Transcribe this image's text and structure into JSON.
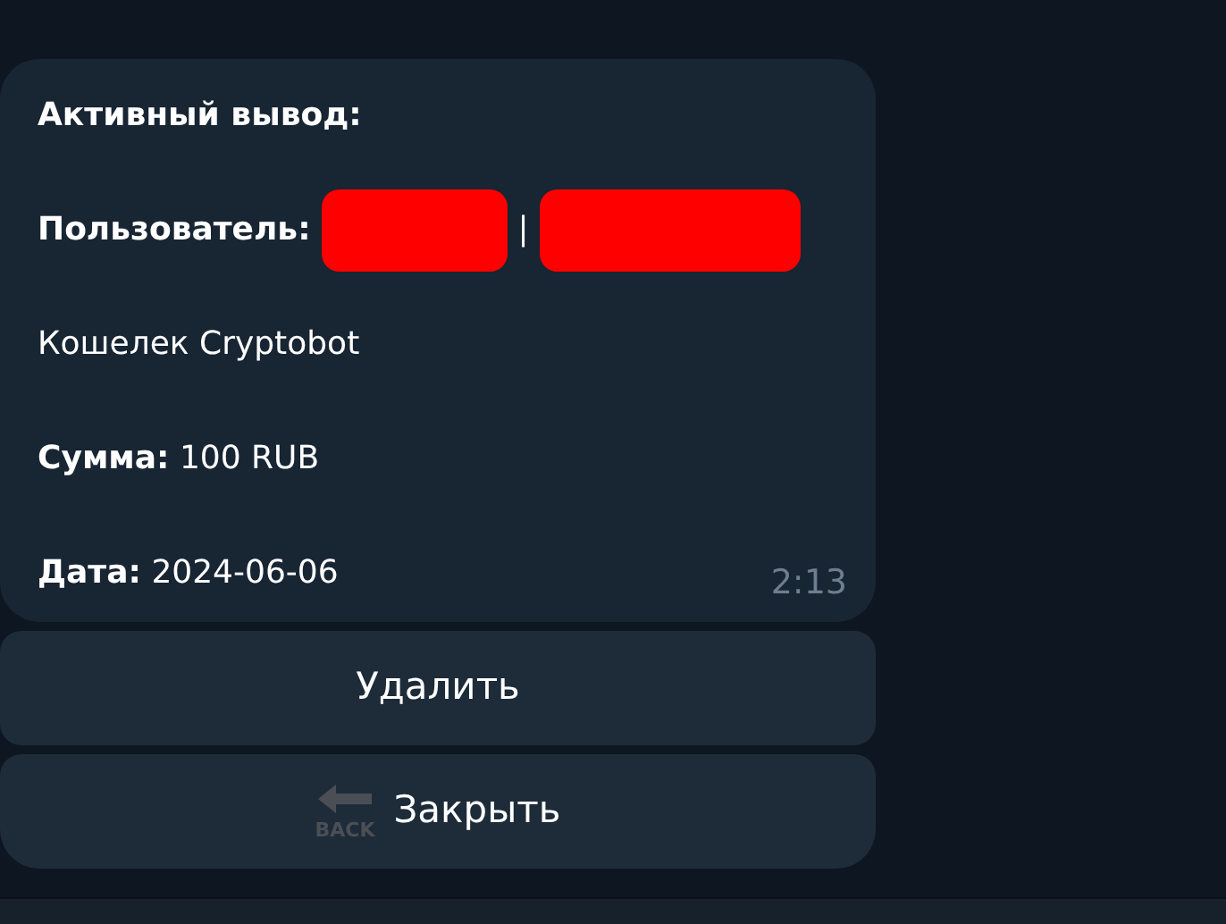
{
  "message": {
    "lines": [
      {
        "kind": "text",
        "text": "Активный вывод:",
        "bold": true
      },
      {
        "kind": "user",
        "label": "Пользователь:",
        "parts": [
          {
            "kind": "redacted"
          },
          {
            "kind": "separator",
            "text": "|"
          },
          {
            "kind": "redacted"
          }
        ]
      },
      {
        "kind": "text",
        "text": "Кошелек Cryptobot",
        "bold": false
      },
      {
        "kind": "text",
        "text": "**Сумма:** 100 RUB",
        "bold": false
      },
      {
        "kind": "text",
        "text": "**Дата:** 2024-06-06",
        "bold": false
      }
    ],
    "time": "2:13"
  },
  "buttons": [
    {
      "label": "Удалить"
    },
    {
      "label": "Закрыть",
      "icon_text": "BACK"
    }
  ]
}
